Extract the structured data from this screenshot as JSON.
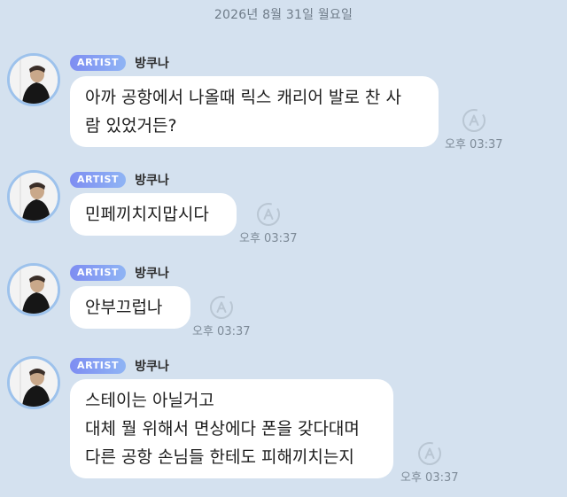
{
  "date_divider": "2026년 8월 31일 월요일",
  "messages": [
    {
      "badge": "ARTIST",
      "sender": "방쿠나",
      "lines": [
        "아까 공항에서 나올때 릭스 캐리어 발로 찬 사",
        "람 있었거든?"
      ],
      "time": "오후 03:37"
    },
    {
      "badge": "ARTIST",
      "sender": "방쿠나",
      "lines": [
        "민페끼치지맙시다"
      ],
      "time": "오후 03:37"
    },
    {
      "badge": "ARTIST",
      "sender": "방쿠나",
      "lines": [
        "안부끄럽나"
      ],
      "time": "오후 03:37"
    },
    {
      "badge": "ARTIST",
      "sender": "방쿠나",
      "lines": [
        "스테이는 아닐거고",
        "대체 뭘 위해서 면상에다 폰을 갖다대며",
        "다른 공항 손님들 한테도 피해끼치는지"
      ],
      "time": "오후 03:37"
    }
  ],
  "colors": {
    "background": "#d4e1ef",
    "bubble": "#ffffff",
    "badge_gradient_start": "#7e8df2",
    "badge_gradient_end": "#8fb4f4",
    "avatar_ring": "#9dc2ec"
  },
  "icons": {
    "translate": "translate-icon",
    "avatar": "artist-avatar"
  }
}
